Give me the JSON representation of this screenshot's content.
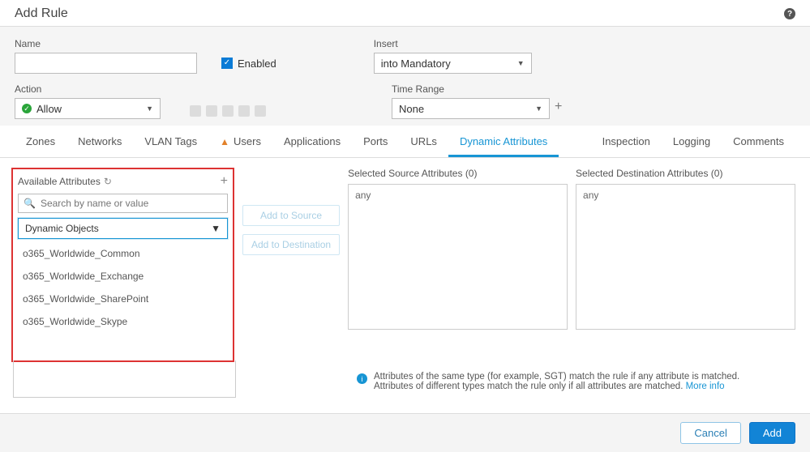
{
  "title": "Add Rule",
  "fields": {
    "name": {
      "label": "Name",
      "value": ""
    },
    "enabled": {
      "label": "Enabled",
      "checked": true
    },
    "insert": {
      "label": "Insert",
      "selected": "into Mandatory"
    },
    "action": {
      "label": "Action",
      "selected": "Allow"
    },
    "time_range": {
      "label": "Time Range",
      "selected": "None"
    }
  },
  "tabs": {
    "items": [
      {
        "label": "Zones"
      },
      {
        "label": "Networks"
      },
      {
        "label": "VLAN Tags"
      },
      {
        "label": "Users",
        "warn": true
      },
      {
        "label": "Applications"
      },
      {
        "label": "Ports"
      },
      {
        "label": "URLs"
      },
      {
        "label": "Dynamic Attributes",
        "active": true
      }
    ],
    "right": [
      {
        "label": "Inspection"
      },
      {
        "label": "Logging"
      },
      {
        "label": "Comments"
      }
    ]
  },
  "available": {
    "title": "Available Attributes",
    "search_placeholder": "Search by name or value",
    "type_selected": "Dynamic Objects",
    "items": [
      "o365_Worldwide_Common",
      "o365_Worldwide_Exchange",
      "o365_Worldwide_SharePoint",
      "o365_Worldwide_Skype"
    ]
  },
  "buttons": {
    "add_source": "Add to Source",
    "add_dest": "Add to Destination"
  },
  "selected_source": {
    "label": "Selected Source Attributes (0)",
    "value": "any"
  },
  "selected_dest": {
    "label": "Selected Destination Attributes (0)",
    "value": "any"
  },
  "hint": {
    "line1": "Attributes of the same type (for example, SGT) match the rule if any attribute is matched.",
    "line2": "Attributes of different types match the rule only if all attributes are matched. ",
    "more": "More info"
  },
  "footer": {
    "cancel": "Cancel",
    "add": "Add"
  }
}
